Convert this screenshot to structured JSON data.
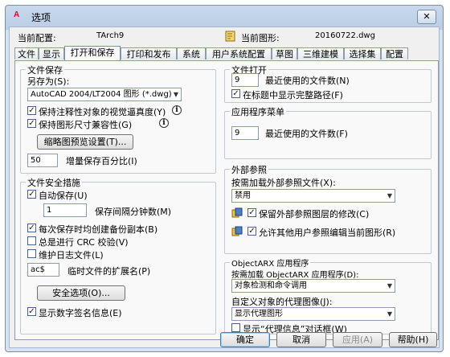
{
  "window": {
    "title": "选项",
    "logo": "A",
    "close_glyph": "✕"
  },
  "header": {
    "current_profile_label": "当前配置:",
    "current_profile_value": "TArch9",
    "current_drawing_label": "当前图形:",
    "current_drawing_value": "20160722.dwg"
  },
  "tabs": [
    "文件",
    "显示",
    "打开和保存",
    "打印和发布",
    "系统",
    "用户系统配置",
    "草图",
    "三维建模",
    "选择集",
    "配置"
  ],
  "active_tab": "打开和保存",
  "file_save": {
    "title": "文件保存",
    "save_as_label": "另存为(S):",
    "save_as_value": "AutoCAD 2004/LT2004 图形 (*.dwg)",
    "maintain_annotative_label": "保持注释性对象的视觉逼真度(Y)",
    "maintain_annotative_checked": true,
    "maintain_size_label": "保持图形尺寸兼容性(G)",
    "maintain_size_checked": true,
    "thumbnail_button": "缩略图预览设置(T)...",
    "incremental_value": "50",
    "incremental_label": "增量保存百分比(I)"
  },
  "file_safety": {
    "title": "文件安全措施",
    "autosave_label": "自动保存(U)",
    "autosave_checked": true,
    "minutes_value": "1",
    "minutes_label": "保存间隔分钟数(M)",
    "backup_label": "每次保存时均创建备份副本(B)",
    "backup_checked": true,
    "crc_label": "总是进行 CRC 校验(V)",
    "crc_checked": false,
    "log_label": "维护日志文件(L)",
    "log_checked": false,
    "temp_ext_value": "ac$",
    "temp_ext_label": "临时文件的扩展名(P)",
    "security_button": "安全选项(O)...",
    "digital_sig_label": "显示数字签名信息(E)",
    "digital_sig_checked": true
  },
  "file_open": {
    "title": "文件打开",
    "recent_value": "9",
    "recent_label": "最近使用的文件数(N)",
    "full_path_label": "在标题中显示完整路径(F)",
    "full_path_checked": true
  },
  "app_menu": {
    "title": "应用程序菜单",
    "recent_value": "9",
    "recent_label": "最近使用的文件数(F)"
  },
  "xref": {
    "title": "外部参照",
    "demand_load_label": "按需加载外部参照文件(X):",
    "demand_load_value": "禁用",
    "retain_changes_label": "保留外部参照图层的修改(C)",
    "retain_changes_checked": true,
    "allow_edit_label": "允许其他用户参照编辑当前图形(R)",
    "allow_edit_checked": true
  },
  "objectarx": {
    "title": "ObjectARX 应用程序",
    "demand_load_label": "按需加载 ObjectARX 应用程序(D):",
    "demand_load_value": "对象检测和命令调用",
    "proxy_label": "自定义对象的代理图像(J):",
    "proxy_value": "显示代理图形",
    "show_proxy_dialog_label": "显示“代理信息”对话框(W)",
    "show_proxy_dialog_checked": false
  },
  "buttons": {
    "ok": "确定",
    "cancel": "取消",
    "apply": "应用(A)",
    "help": "帮助(H)"
  },
  "icons": {
    "info": "i",
    "check": "✓",
    "dropdown": "▼"
  }
}
